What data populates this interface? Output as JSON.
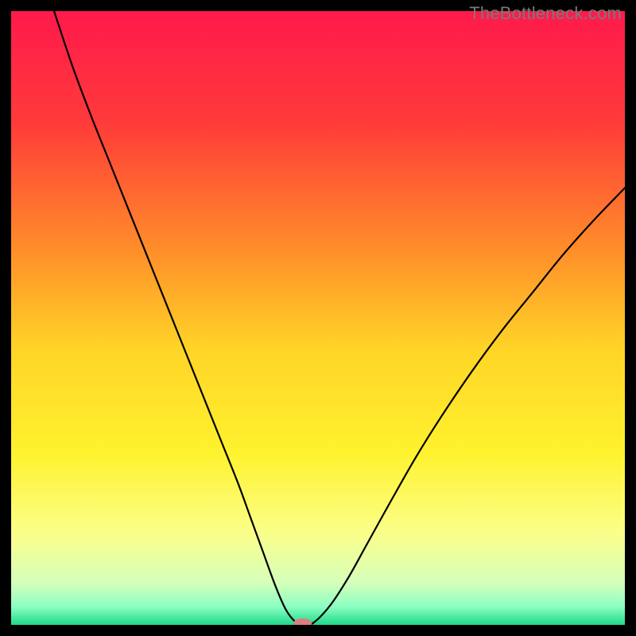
{
  "attribution": "TheBottleneck.com",
  "chart_data": {
    "type": "line",
    "title": "",
    "xlabel": "",
    "ylabel": "",
    "xlim": [
      0,
      100
    ],
    "ylim": [
      0,
      100
    ],
    "grid": false,
    "legend": false,
    "gradient_stops": [
      {
        "offset": 0.0,
        "color": "#ff1a4c"
      },
      {
        "offset": 0.18,
        "color": "#ff3a3a"
      },
      {
        "offset": 0.38,
        "color": "#ff8a2a"
      },
      {
        "offset": 0.55,
        "color": "#ffd427"
      },
      {
        "offset": 0.72,
        "color": "#fff22e"
      },
      {
        "offset": 0.85,
        "color": "#fbff8a"
      },
      {
        "offset": 0.93,
        "color": "#d6ffba"
      },
      {
        "offset": 0.97,
        "color": "#8dffc2"
      },
      {
        "offset": 1.0,
        "color": "#1fd98a"
      }
    ],
    "series": [
      {
        "name": "bottleneck-curve",
        "color": "#000000",
        "stroke_width": 2.2,
        "valley_x": 47.5,
        "x": [
          7,
          10,
          13,
          16,
          19,
          22,
          25,
          28,
          31,
          34,
          37,
          39,
          41,
          43,
          44.7,
          46.2,
          47.5,
          49.2,
          52,
          55,
          58,
          62,
          66,
          70,
          75,
          80,
          85,
          90,
          95,
          100
        ],
        "y": [
          100,
          91,
          83,
          75.5,
          68,
          60.5,
          53,
          45.5,
          38,
          30.5,
          23,
          17.5,
          12,
          6.5,
          2.6,
          0.6,
          0,
          0.3,
          3.2,
          7.8,
          13.2,
          20.4,
          27.4,
          33.8,
          41.2,
          48.0,
          54.2,
          60.4,
          66.0,
          71.2
        ]
      }
    ],
    "valley_marker": {
      "x": 47.5,
      "y": 0,
      "rx": 1.5,
      "ry": 0.8,
      "fill": "#d98080"
    }
  },
  "colors": {
    "page_bg": "#000000",
    "watermark": "#7a7a7a"
  }
}
